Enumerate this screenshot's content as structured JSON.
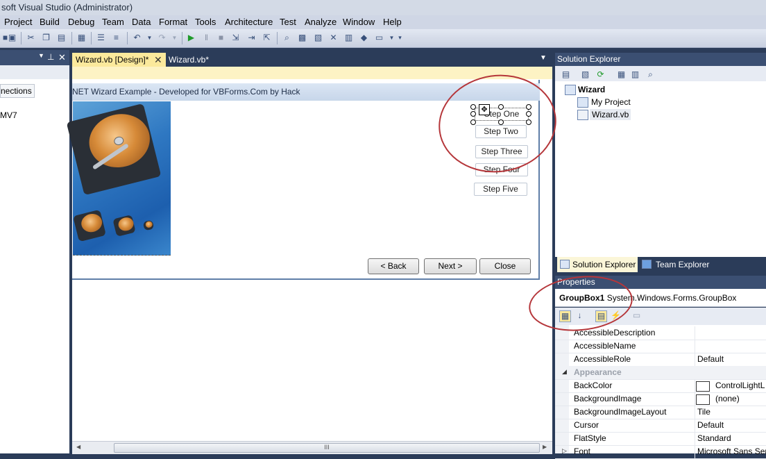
{
  "window": {
    "title": "soft Visual Studio (Administrator)"
  },
  "menu": [
    "Project",
    "Build",
    "Debug",
    "Team",
    "Data",
    "Format",
    "Tools",
    "Architecture",
    "Test",
    "Analyze",
    "Window",
    "Help"
  ],
  "left_panel": {
    "connections_label": "nections",
    "item_label": "MV7"
  },
  "tabs": [
    {
      "label": "Wizard.vb [Design]*",
      "active": true
    },
    {
      "label": "Wizard.vb*",
      "active": false
    }
  ],
  "form": {
    "title": "NET Wizard Example - Developed for VBForms.Com by Hack",
    "steps": [
      "Step One",
      "Step Two",
      "Step Three",
      "Step Four",
      "Step Five"
    ],
    "buttons": {
      "back": "< Back",
      "next": "Next >",
      "close": "Close"
    }
  },
  "scrollbar": {
    "grip": "III"
  },
  "solution_explorer": {
    "title": "Solution Explorer",
    "tree": {
      "root": "Wizard",
      "children": [
        "My Project",
        "Wizard.vb"
      ]
    },
    "tabs": [
      "Solution Explorer",
      "Team Explorer"
    ]
  },
  "properties": {
    "title": "Properties",
    "object_name": "GroupBox1",
    "object_type": "System.Windows.Forms.GroupBox",
    "rows": [
      {
        "name": "AccessibleDescription",
        "value": ""
      },
      {
        "name": "AccessibleName",
        "value": ""
      },
      {
        "name": "AccessibleRole",
        "value": "Default"
      },
      {
        "category": "Appearance"
      },
      {
        "name": "BackColor",
        "value": "ControlLightL",
        "swatch": true
      },
      {
        "name": "BackgroundImage",
        "value": "(none)",
        "swatch": true
      },
      {
        "name": "BackgroundImageLayout",
        "value": "Tile"
      },
      {
        "name": "Cursor",
        "value": "Default"
      },
      {
        "name": "FlatStyle",
        "value": "Standard"
      },
      {
        "name": "Font",
        "value": "Microsoft Sans Seri"
      }
    ]
  },
  "colors": {
    "chrome_dark": "#2b3c59",
    "panel_header": "#3b4f72",
    "active_tab": "#fbe99c",
    "annotation": "#b5363a"
  }
}
